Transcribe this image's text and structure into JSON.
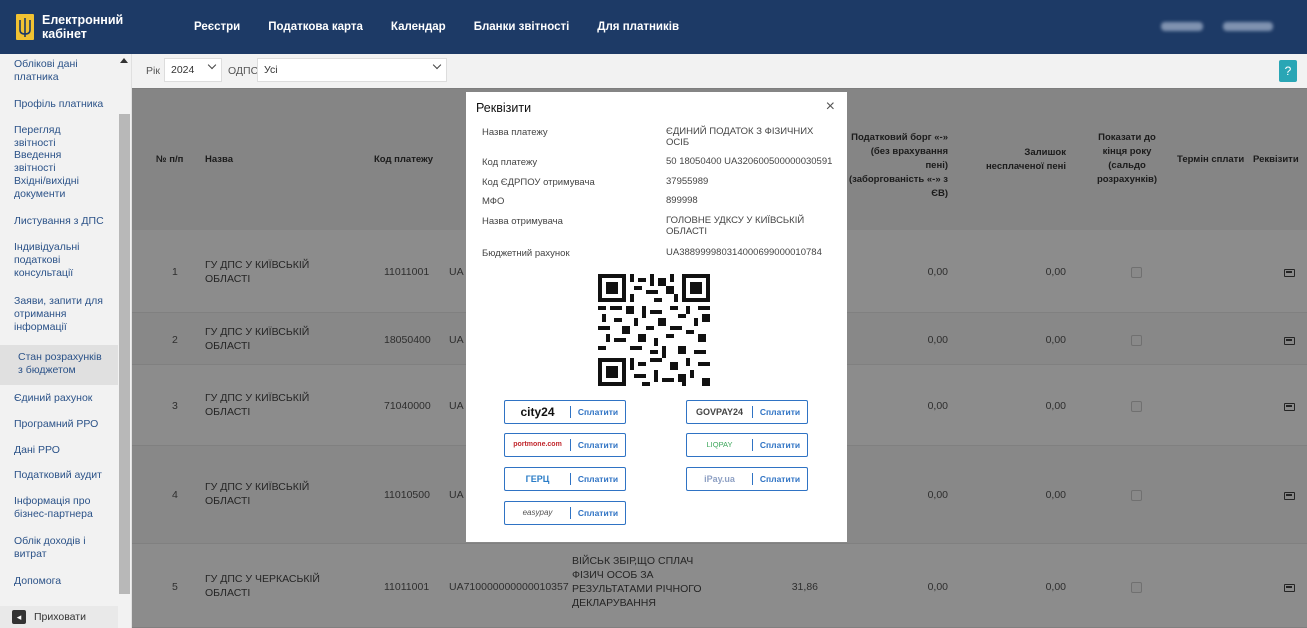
{
  "header": {
    "brand": "Електронний кабінет",
    "nav": [
      "Реєстри",
      "Податкова карта",
      "Календар",
      "Бланки звітності",
      "Для платників"
    ]
  },
  "sidebar": {
    "items": [
      "Облікові дані платника",
      "Профіль платника",
      "Перегляд звітності",
      "Введення звітності",
      "Вхідні/вихідні документи",
      "Листування з ДПС",
      "Індивідуальні податкові консультації",
      "Заяви, запити для отримання інформації",
      "Стан розрахунків з бюджетом",
      "Єдиний рахунок",
      "Програмний РРО",
      "Дані РРО",
      "Податковий аудит",
      "Інформація про бізнес-партнера",
      "Облік доходів і витрат",
      "Допомога"
    ],
    "hide_label": "Приховати"
  },
  "filters": {
    "year_label": "Рік",
    "year_value": "2024",
    "odps_label": "ОДПС",
    "odps_value": "Усі",
    "help": "?"
  },
  "table": {
    "headers": {
      "num": "№ п/п",
      "name": "Назва",
      "code": "Код платежу",
      "debt": "Податковий борг «-» (без врахування пені) (заборгованість «-» з ЄВ)",
      "penalty": "Залишок несплаченої пені",
      "show_end": "Показати до кінця року (сальдо розрахунків)",
      "term": "Термін сплати",
      "requisites": "Реквізити"
    },
    "rows": [
      {
        "num": "1",
        "name": "ГУ ДПС У КИЇВСЬКІЙ ОБЛАСТІ",
        "code": "11011001",
        "acct": "UA",
        "debt": "0,00",
        "penalty": "0,00"
      },
      {
        "num": "2",
        "name": "ГУ ДПС У КИЇВСЬКІЙ ОБЛАСТІ",
        "code": "18050400",
        "acct": "UA",
        "debt": "0,00",
        "penalty": "0,00"
      },
      {
        "num": "3",
        "name": "ГУ ДПС У КИЇВСЬКІЙ ОБЛАСТІ",
        "code": "71040000",
        "acct": "UA",
        "debt": "0,00",
        "penalty": "0,00"
      },
      {
        "num": "4",
        "name": "ГУ ДПС У КИЇВСЬКІЙ ОБЛАСТІ",
        "code": "11010500",
        "acct": "UA",
        "debt": "0,00",
        "penalty": "0,00"
      },
      {
        "num": "5",
        "name": "ГУ ДПС У ЧЕРКАСЬКІЙ ОБЛАСТІ",
        "code": "11011001",
        "acct": "UA710000000000010357",
        "desc": "ВІЙСЬК ЗБІР,ЩО СПЛАЧ ФІЗИЧ ОСОБ ЗА РЕЗУЛЬТАТАМИ РІЧНОГО ДЕКЛАРУВАННЯ",
        "amount": "31,86",
        "debt": "0,00",
        "penalty": "0,00"
      }
    ]
  },
  "modal": {
    "title": "Реквізити",
    "close": "×",
    "fields": [
      {
        "label": "Назва платежу",
        "value": "ЄДИНИЙ ПОДАТОК З ФІЗИЧНИХ ОСІБ"
      },
      {
        "label": "Код платежу",
        "value": "50 18050400 UA320600500000030591"
      },
      {
        "label": "Код ЄДРПОУ отримувача",
        "value": "37955989"
      },
      {
        "label": "МФО",
        "value": "899998"
      },
      {
        "label": "Назва отримувача",
        "value": "ГОЛОВНЕ УДКСУ У КИЇВСЬКІЙ ОБЛАСТІ"
      },
      {
        "label": "Бюджетний рахунок",
        "value": "UA388999980314000699000010784"
      }
    ],
    "pay_label": "Сплатити",
    "providers": [
      "city24",
      "GOVPAY24",
      "portmone.com",
      "LIQPAY",
      "ГЕРЦ",
      "iPay.ua",
      "easypay"
    ]
  }
}
